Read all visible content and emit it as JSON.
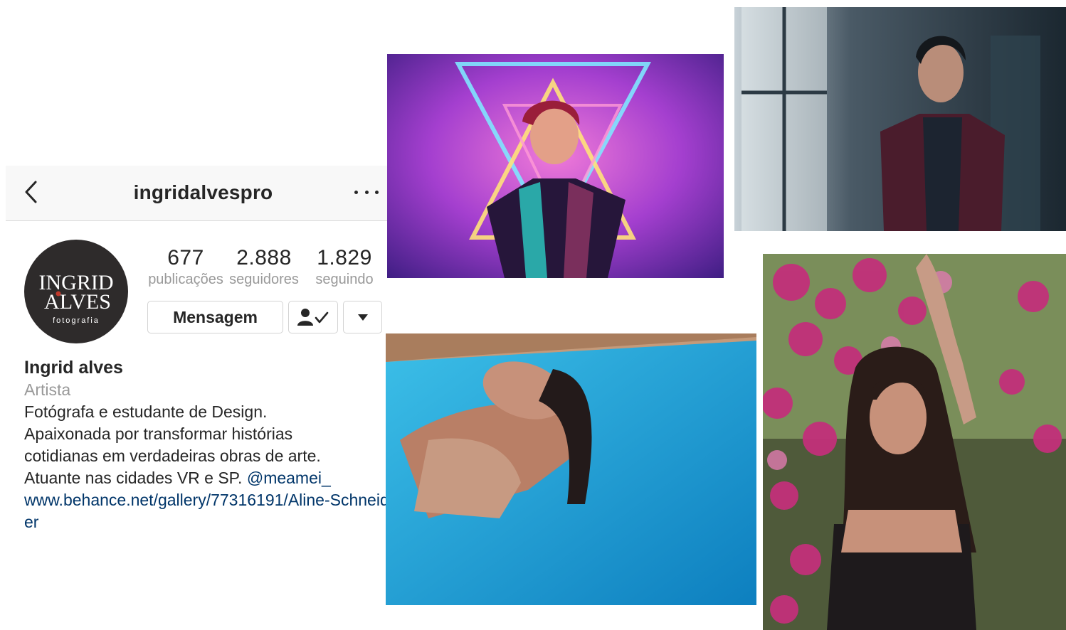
{
  "header": {
    "username": "ingridalvespro",
    "back_icon": "chevron-left-icon",
    "more_icon": "more-horizontal-icon"
  },
  "avatar": {
    "line1": "INGRID",
    "line2": "ALVES",
    "line3": "fotografia"
  },
  "stats": [
    {
      "value": "677",
      "label": "publicações"
    },
    {
      "value": "2.888",
      "label": "seguidores"
    },
    {
      "value": "1.829",
      "label": "seguindo"
    }
  ],
  "actions": {
    "message_label": "Mensagem",
    "following_icon": "person-check-icon",
    "dropdown_icon": "caret-down-icon"
  },
  "bio": {
    "name": "Ingrid alves",
    "category": "Artista",
    "line1": "Fotógrafa e estudante de Design.",
    "line2": "Apaixonada por transformar histórias",
    "line3": "cotidianas em verdadeiras obras de arte.",
    "line4_prefix": "Atuante nas cidades VR e SP. ",
    "mention": "@meamei_",
    "link": "www.behance.net/gallery/77316191/Aline-Schneider"
  },
  "colors": {
    "link": "#003569",
    "muted": "#999999",
    "avatar_bg": "#2e2b2b",
    "avatar_dot": "#c0392b"
  }
}
